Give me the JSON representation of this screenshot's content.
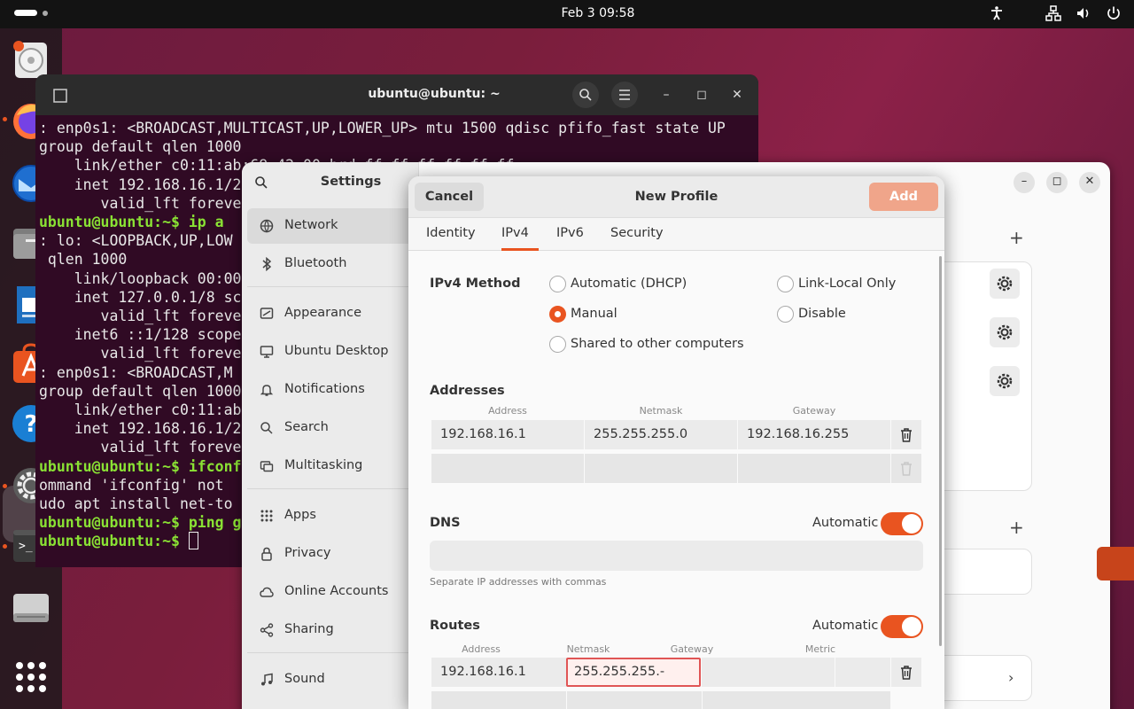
{
  "topbar": {
    "clock": "Feb 3  09:58",
    "icons": [
      "accessibility-icon",
      "network-icon",
      "volume-icon",
      "power-icon"
    ]
  },
  "dock": {
    "apps": [
      "disk-usage-icon",
      "firefox-icon",
      "thunderbird-icon",
      "files-icon",
      "writer-icon",
      "app-center-icon",
      "help-icon",
      "settings-icon",
      "terminal-icon",
      "drive-icon",
      "show-apps-icon"
    ]
  },
  "terminal": {
    "title": "ubuntu@ubuntu: ~",
    "lines": [
      ": enp0s1: <BROADCAST,MULTICAST,UP,LOWER_UP> mtu 1500 qdisc pfifo_fast state UP",
      "group default qlen 1000",
      "    link/ether c0:11:ab:69:42:00 brd ff:ff:ff:ff:ff:ff",
      "    inet 192.168.16.1/2",
      "       valid_lft foreve",
      "ubuntu@ubuntu:~$ ip a",
      ": lo: <LOOPBACK,UP,LOW",
      " qlen 1000",
      "    link/loopback 00:00",
      "    inet 127.0.0.1/8 sc",
      "       valid_lft foreve",
      "    inet6 ::1/128 scope",
      "       valid_lft foreve",
      ": enp0s1: <BROADCAST,M",
      "group default qlen 1000",
      "    link/ether c0:11:ab",
      "    inet 192.168.16.1/2",
      "       valid_lft foreve",
      "ubuntu@ubuntu:~$ ifconf",
      "ommand 'ifconfig' not",
      "udo apt install net-to",
      "ubuntu@ubuntu:~$ ping g",
      "",
      "ubuntu@ubuntu:~$ "
    ]
  },
  "settings": {
    "title": "Settings",
    "sidebar": [
      {
        "label": "Network",
        "icon": "network-icon"
      },
      {
        "label": "Bluetooth",
        "icon": "bluetooth-icon"
      },
      {
        "label": "Appearance",
        "icon": "appearance-icon"
      },
      {
        "label": "Ubuntu Desktop",
        "icon": "desktop-icon"
      },
      {
        "label": "Notifications",
        "icon": "bell-icon"
      },
      {
        "label": "Search",
        "icon": "search-icon"
      },
      {
        "label": "Multitasking",
        "icon": "multitasking-icon"
      },
      {
        "label": "Apps",
        "icon": "apps-icon"
      },
      {
        "label": "Privacy",
        "icon": "lock-icon"
      },
      {
        "label": "Online Accounts",
        "icon": "cloud-icon"
      },
      {
        "label": "Sharing",
        "icon": "share-icon"
      },
      {
        "label": "Sound",
        "icon": "music-icon"
      }
    ]
  },
  "dialog": {
    "cancel": "Cancel",
    "title": "New Profile",
    "add": "Add",
    "tabs": [
      "Identity",
      "IPv4",
      "IPv6",
      "Security"
    ],
    "active_tab": "IPv4",
    "ipv4_method_label": "IPv4 Method",
    "methods": {
      "auto": "Automatic (DHCP)",
      "link_local": "Link-Local Only",
      "manual": "Manual",
      "disable": "Disable",
      "shared": "Shared to other computers"
    },
    "selected_method": "Manual",
    "addresses_label": "Addresses",
    "address_cols": [
      "Address",
      "Netmask",
      "Gateway"
    ],
    "address_row": {
      "address": "192.168.16.1",
      "netmask": "255.255.255.0",
      "gateway": "192.168.16.255"
    },
    "dns_label": "DNS",
    "dns_auto_label": "Automatic",
    "dns_hint": "Separate IP addresses with commas",
    "routes_label": "Routes",
    "routes_auto_label": "Automatic",
    "route_cols": [
      "Address",
      "Netmask",
      "Gateway",
      "Metric"
    ],
    "route_row": {
      "address": "192.168.16.1",
      "netmask": "255.255.255.-"
    }
  }
}
